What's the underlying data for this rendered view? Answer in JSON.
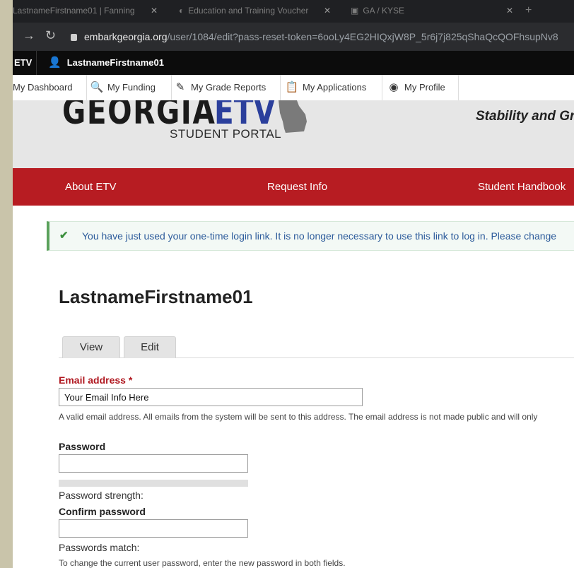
{
  "browser": {
    "tabs": [
      {
        "label": "LastnameFirstname01 | Fanning"
      },
      {
        "label": "Education and Training Voucher"
      },
      {
        "label": "GA / KYSE"
      }
    ],
    "url_host": "embarkgeorgia.org",
    "url_path": "/user/1084/edit?pass-reset-token=6ooLy4EG2HIQxjW8P_5r6j7j825qShaQcQOFhsupNv8"
  },
  "admin_bar": {
    "site": "ETV",
    "username": "LastnameFirstname01"
  },
  "user_toolbar": {
    "items": [
      {
        "label": "My Dashboard",
        "icon": "dashboard-icon"
      },
      {
        "label": "My Funding",
        "icon": "funding-icon"
      },
      {
        "label": "My Grade Reports",
        "icon": "pencil-icon"
      },
      {
        "label": "My Applications",
        "icon": "clipboard-icon"
      },
      {
        "label": "My Profile",
        "icon": "profile-icon"
      }
    ]
  },
  "header": {
    "logo_word": "GEORGIA",
    "logo_etv": "ETV",
    "logo_sub": "STUDENT PORTAL",
    "tagline": "Stability and Gr"
  },
  "main_nav": {
    "items": [
      "About ETV",
      "Request Info",
      "Student Handbook"
    ]
  },
  "message": {
    "text": "You have just used your one-time login link. It is no longer necessary to use this link to log in. Please change"
  },
  "page": {
    "title": "LastnameFirstname01",
    "tabs": [
      "View",
      "Edit"
    ]
  },
  "form": {
    "email_label": "Email address",
    "required_mark": "*",
    "email_value": "Your Email Info Here",
    "email_help": "A valid email address. All emails from the system will be sent to this address. The email address is not made public and will only",
    "password_label": "Password",
    "password_strength_label": "Password strength:",
    "confirm_label": "Confirm password",
    "passwords_match_label": "Passwords match:",
    "password_help": "To change the current user password, enter the new password in both fields."
  },
  "colors": {
    "brand_red": "#b71c22",
    "brand_blue": "#2b3f9c",
    "success_green": "#5aa15b"
  }
}
